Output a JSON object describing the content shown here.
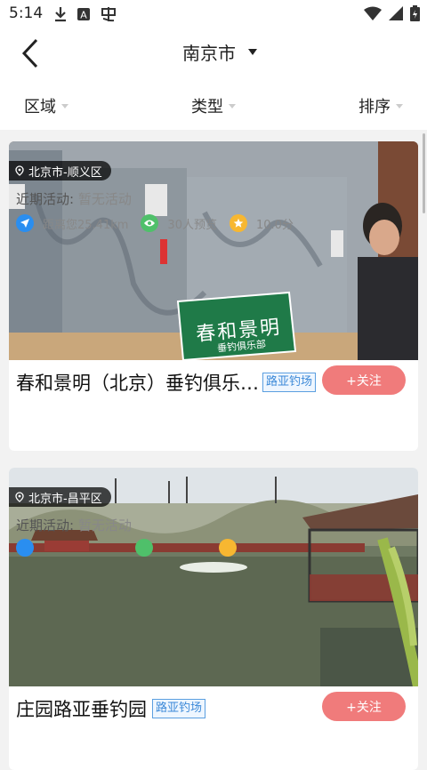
{
  "status": {
    "time": "5:14"
  },
  "header": {
    "city": "南京市"
  },
  "filters": [
    {
      "label": "区域"
    },
    {
      "label": "类型"
    },
    {
      "label": "排序"
    }
  ],
  "cards": [
    {
      "location": "北京市-顺义区",
      "sign_text": "春和景明",
      "sign_sub": "垂钓俱乐部",
      "title": "春和景明（北京）垂钓俱乐…",
      "tag": "路亚钓场",
      "follow": "+关注",
      "activity_label": "近期活动:",
      "activity_value": "暂无活动",
      "distance": "距离您25.41km",
      "views": "30人预览",
      "score": "10.0分"
    },
    {
      "location": "北京市-昌平区",
      "title": "庄园路亚垂钓园",
      "tag": "路亚钓场",
      "follow": "+关注",
      "activity_label": "近期活动:",
      "activity_value": "暂无活动"
    }
  ],
  "colors": {
    "accent": "#f07b7b",
    "tag": "#3d8ad8",
    "distance_icon": "#2a8ef0",
    "views_icon": "#4fc06a",
    "score_icon": "#f7b731"
  }
}
